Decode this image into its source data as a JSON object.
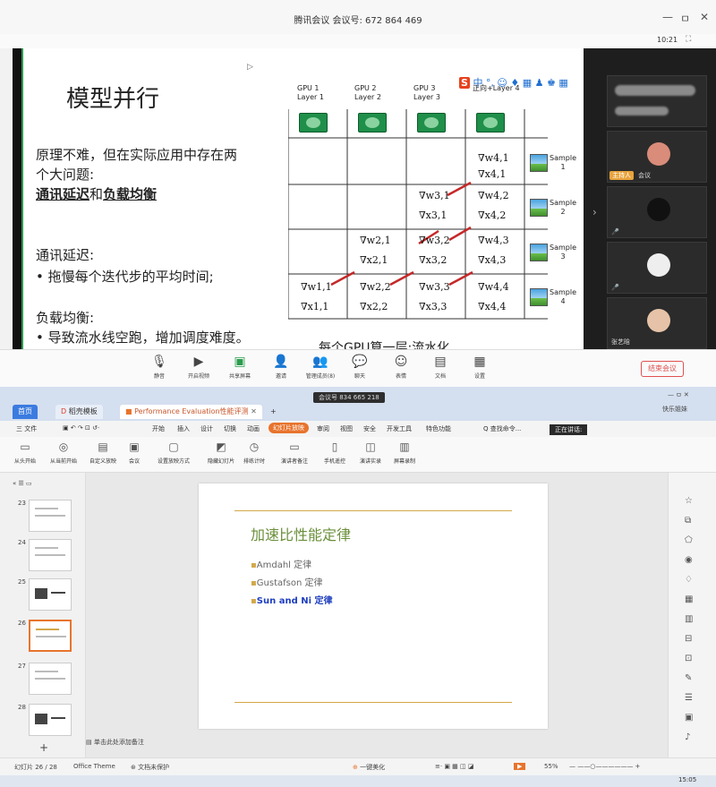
{
  "meeting": {
    "title": "腾讯会议 会议号: 672 864 469",
    "window_controls": [
      "—",
      "ㅁ",
      "✕"
    ],
    "clock": "10:21",
    "fullscreen_icon": "fullscreen-icon",
    "slide": {
      "title": "模型并行",
      "text_lines": [
        "原理不难，但在实际应用中存在两",
        "个大问题:",
        "通讯延迟和负载均衡",
        "通讯延迟:",
        "• 拖慢每个迭代步的平均时间;",
        "负载均衡:",
        "• 导致流水线空跑，增加调度难度。"
      ],
      "underline_a": "通讯延迟",
      "underline_mid": "和",
      "underline_b": "负载均衡",
      "bottom_cut_text": "每个GPU算一层:流水化",
      "gpus": [
        {
          "line1": "GPU 1",
          "line2": "Layer 1"
        },
        {
          "line1": "GPU 2",
          "line2": "Layer 2"
        },
        {
          "line1": "GPU 3",
          "line2": "Layer 3"
        },
        {
          "line1": "",
          "line2": "正向+Layer 4"
        }
      ],
      "samples": [
        {
          "line1": "Sample",
          "line2": "1"
        },
        {
          "line1": "Sample",
          "line2": "2"
        },
        {
          "line1": "Sample",
          "line2": "3"
        },
        {
          "line1": "Sample",
          "line2": "4"
        }
      ],
      "cells": {
        "r1c4": [
          "∇w4,1",
          "∇x4,1"
        ],
        "r2c3": [
          "∇w3,1",
          "∇x3,1"
        ],
        "r2c4": [
          "∇w4,2",
          "∇x4,2"
        ],
        "r3c2": [
          "∇w2,1",
          "∇x2,1"
        ],
        "r3c3": [
          "∇w3,2",
          "∇x3,2"
        ],
        "r3c4": [
          "∇w4,3",
          "∇x4,3"
        ],
        "r4c1": [
          "∇w1,1",
          "∇x1,1"
        ],
        "r4c2": [
          "∇w2,2",
          "∇x2,2"
        ],
        "r4c3": [
          "∇w3,3",
          "∇x3,3"
        ],
        "r4c4": [
          "∇w4,4",
          "∇x4,4"
        ]
      },
      "ime_bar": "中 °, ☺ ♦ ▦ ♟ ♚ ▦"
    },
    "participants": {
      "host_tag": "主持人",
      "host_mic": "会议",
      "bottom_name": "张艺晗"
    },
    "toolbar": [
      {
        "icon": "mic-icon",
        "label": "静音"
      },
      {
        "icon": "video-icon",
        "label": "开启视频"
      },
      {
        "icon": "share-screen-icon",
        "label": "共享屏幕"
      },
      {
        "icon": "invite-icon",
        "label": "邀请"
      },
      {
        "icon": "members-icon",
        "label": "管理成员(8)"
      },
      {
        "icon": "chat-icon",
        "label": "聊天"
      },
      {
        "icon": "reaction-icon",
        "label": "表情"
      },
      {
        "icon": "doc-icon",
        "label": "文档"
      },
      {
        "icon": "settings-icon",
        "label": "设置"
      }
    ],
    "end_button": "结束会议"
  },
  "wps": {
    "meeting_id": "会议号 834 665 218",
    "tabs": [
      {
        "label": "首页"
      },
      {
        "label": "稻壳模板"
      },
      {
        "label": "Performance Evaluation性能评测"
      },
      {
        "label": "+"
      }
    ],
    "account": "快乐姐妹",
    "speaking_label": "正在讲话:",
    "menu": [
      "三 文件",
      "开始",
      "插入",
      "设计",
      "切换",
      "动画",
      "幻灯片放映",
      "审阅",
      "视图",
      "安全",
      "开发工具",
      "特色功能",
      "Q 查找命令..."
    ],
    "ribbon": [
      {
        "icon": "play-from-start-icon",
        "label": "从头开始"
      },
      {
        "icon": "play-current-icon",
        "label": "从当前开始"
      },
      {
        "icon": "custom-show-icon",
        "label": "自定义放映"
      },
      {
        "icon": "meeting-icon",
        "label": "会议"
      },
      {
        "icon": "setup-show-icon",
        "label": "设置放映方式"
      },
      {
        "icon": "hide-slide-icon",
        "label": "隐藏幻灯片"
      },
      {
        "icon": "rehearse-icon",
        "label": "排练计时"
      },
      {
        "icon": "presenter-notes-icon",
        "label": "演讲者备注"
      },
      {
        "icon": "phone-remote-icon",
        "label": "手机遥控"
      },
      {
        "icon": "live-record-icon",
        "label": "演讲实录"
      },
      {
        "icon": "screen-record-icon",
        "label": "屏幕录制"
      }
    ],
    "thumbnails": [
      "23",
      "24",
      "25",
      "26",
      "27",
      "28"
    ],
    "selected_thumb": "26",
    "add_slide": "+",
    "notes_placeholder": "单击此处添加备注",
    "slide": {
      "title": "加速比性能定律",
      "bullets": [
        "Amdahl 定律",
        "Gustafson 定律",
        "Sun and Ni 定律"
      ]
    },
    "status": {
      "slide_count": "幻灯片 26 / 28",
      "theme": "Office Theme",
      "protect": "文档未保护",
      "beautify": "一键美化",
      "zoom": "55%"
    },
    "taskbar_time": "15:05"
  }
}
